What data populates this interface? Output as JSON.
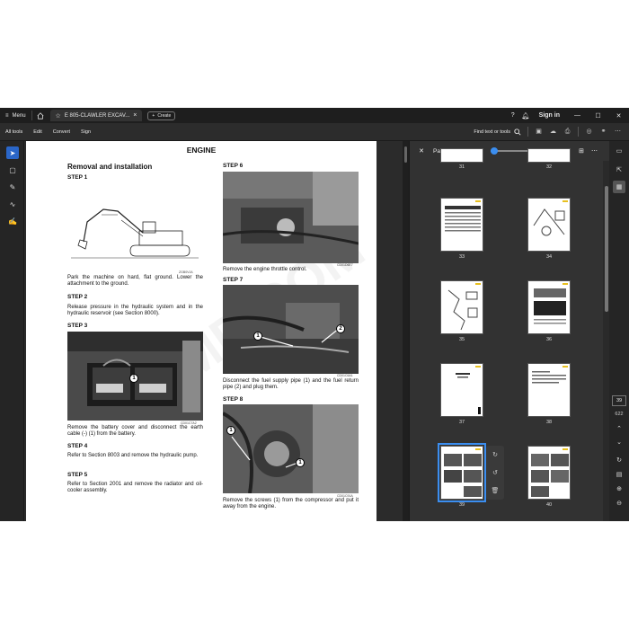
{
  "titlebar": {
    "menu_label": "Menu",
    "tab_title": "E 805-CLAWLER EXCAV...",
    "create_label": "Create",
    "sign_in": "Sign in"
  },
  "toolbar": {
    "items": [
      "All tools",
      "Edit",
      "Convert",
      "Sign"
    ],
    "find_label": "Find text or tools"
  },
  "document": {
    "header": "ENGINE",
    "section_title": "Removal and installation",
    "steps": [
      {
        "label": "STEP 1",
        "fig_code": "ZGB0VJA",
        "text": "Park the machine on hard, flat ground. Lower the attachment to the ground."
      },
      {
        "label": "STEP 2",
        "text": "Release pressure in the hydraulic system and in the hydraulic reservoir (see Section 8000)."
      },
      {
        "label": "STEP 3",
        "fig_code": "CD01C7A2",
        "text": "Remove the battery cover and disconnect the earth cable (-) (1) from the battery."
      },
      {
        "label": "STEP 4",
        "text": "Refer to Section 8003 and remove the hydraulic pump."
      },
      {
        "label": "STEP 5",
        "text": "Refer to Section 2001 and remove the radiator and oil-cooler assembly."
      },
      {
        "label": "STEP 6",
        "fig_code": "CD01D6E7",
        "text": "Remove the engine throttle control."
      },
      {
        "label": "STEP 7",
        "fig_code": "CD01C6A1",
        "text": "Disconnect the fuel supply pipe (1) and the fuel return pipe (2) and plug them."
      },
      {
        "label": "STEP 8",
        "fig_code": "CD01C91A",
        "text": "Remove the screws (1) from the compressor and put it away from the engine."
      }
    ],
    "callouts": [
      "1",
      "1",
      "2",
      "1",
      "1"
    ],
    "watermark": "MD.COM"
  },
  "panel": {
    "title": "Pages",
    "zoom_fraction": 0.05,
    "thumbnails": [
      "31",
      "32",
      "33",
      "34",
      "35",
      "36",
      "37",
      "38",
      "39",
      "40"
    ],
    "selected": "39"
  },
  "navigation": {
    "current_page": "39",
    "total_pages": "622"
  },
  "colors": {
    "accent": "#3b8ef0",
    "active_tool": "#2a66c8",
    "titlebar_bg": "#1e1e1e",
    "panel_bg": "#323232"
  }
}
